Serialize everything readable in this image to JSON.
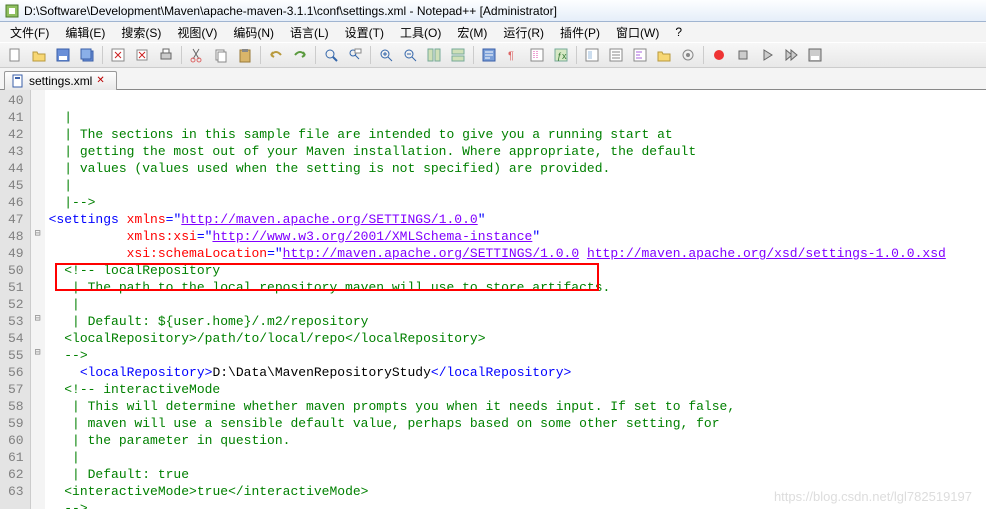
{
  "title": "D:\\Software\\Development\\Maven\\apache-maven-3.1.1\\conf\\settings.xml - Notepad++ [Administrator]",
  "menu": [
    "文件(F)",
    "编辑(E)",
    "搜索(S)",
    "视图(V)",
    "编码(N)",
    "语言(L)",
    "设置(T)",
    "工具(O)",
    "宏(M)",
    "运行(R)",
    "插件(P)",
    "窗口(W)",
    "?"
  ],
  "tab": {
    "name": "settings.xml"
  },
  "lines": {
    "start": 40,
    "end": 63,
    "fold": [
      "",
      "",
      "",
      "",
      "",
      "",
      "",
      "",
      "⊟",
      "",
      "",
      "",
      "",
      "⊟",
      "",
      "⊟",
      "",
      "",
      "",
      "",
      "",
      "",
      "",
      ""
    ]
  },
  "code": {
    "l40": "  |",
    "l41": "  | The sections in this sample file are intended to give you a running start at",
    "l42": "  | getting the most out of your Maven installation. Where appropriate, the default",
    "l43": "  | values (values used when the setting is not specified) are provided.",
    "l44": "  |",
    "l45": "  |-->",
    "l46_open": "<settings",
    "l46_a1": "xmlns",
    "l46_v1": "http://maven.apache.org/SETTINGS/1.0.0",
    "l47_a1": "xmlns:xsi",
    "l47_v1": "http://www.w3.org/2001/XMLSchema-instance",
    "l48_a1": "xsi:schemaLocation",
    "l48_v1": "http://maven.apache.org/SETTINGS/1.0.0",
    "l48_v2": "http://maven.apache.org/xsd/settings-1.0.0.xsd",
    "l49": "  <!-- localRepository",
    "l50": "   | The path to the local repository maven will use to store artifacts.",
    "l51": "   |",
    "l52": "   | Default: ${user.home}/.m2/repository",
    "l53_open": "<localRepository>",
    "l53_text": "/path/to/local/repo",
    "l53_close": "</localRepository>",
    "l54": "  -->",
    "l55_open": "<localRepository>",
    "l55_text": "D:\\Data\\MavenRepositoryStudy",
    "l55_close": "</localRepository>",
    "l56": "  <!-- interactiveMode",
    "l57": "   | This will determine whether maven prompts you when it needs input. If set to false,",
    "l58": "   | maven will use a sensible default value, perhaps based on some other setting, for",
    "l59": "   | the parameter in question.",
    "l60": "   |",
    "l61": "   | Default: true",
    "l62_open": "<interactiveMode>",
    "l62_text": "true",
    "l62_close": "</interactiveMode>",
    "l63": "  -->"
  },
  "watermark": "https://blog.csdn.net/lgl782519197"
}
